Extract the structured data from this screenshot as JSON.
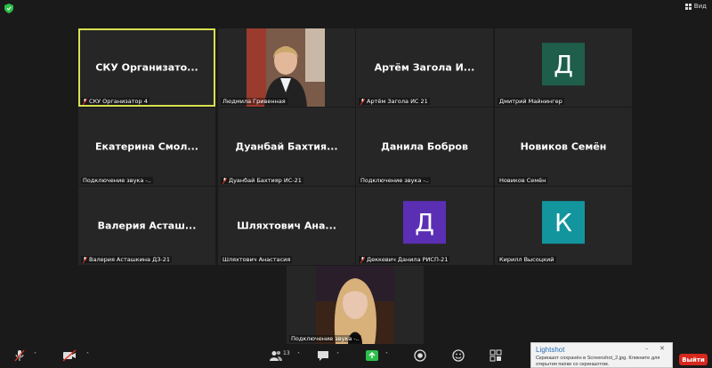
{
  "top_bar": {
    "view_label": "Вид",
    "security_color": "#2dbe4b"
  },
  "participants": [
    {
      "display_name": "СКУ Организато...",
      "label": "СКУ Организатор 4",
      "muted": true,
      "active": true
    },
    {
      "display_name": "",
      "label": "Людмила Гривенная",
      "muted": false,
      "photo": true
    },
    {
      "display_name": "Артём Загола И...",
      "label": "Артём Загола ИС 21",
      "muted": true
    },
    {
      "display_name": "",
      "label": "Дмитрий Майнингер",
      "muted": false,
      "avatar_letter": "Д",
      "avatar_color": "#1e5e4a"
    },
    {
      "display_name": "Екатерина Смол...",
      "label": "Подключение звука -..",
      "muted": false
    },
    {
      "display_name": "Дуанбай Бахтия...",
      "label": "Дуанбай Бахтияр ИС-21",
      "muted": true
    },
    {
      "display_name": "Данила Бобров",
      "label": "Подключение звука -..",
      "muted": false
    },
    {
      "display_name": "Новиков Семён",
      "label": "Новиков Семён",
      "muted": false
    },
    {
      "display_name": "Валерия Асташ...",
      "label": "Валерия Асташкина ДЗ-21",
      "muted": true
    },
    {
      "display_name": "Шляхтович Ана...",
      "label": "Шляхтович Анастасия",
      "muted": false
    },
    {
      "display_name": "",
      "label": "Деккевич Данила РИСП-21",
      "muted": true,
      "avatar_letter": "Д",
      "avatar_color": "#5b2fb3"
    },
    {
      "display_name": "",
      "label": "Кирилл Высоцкий",
      "muted": false,
      "avatar_letter": "К",
      "avatar_color": "#13959e"
    },
    {
      "display_name": "",
      "label": "Подключение звука -..",
      "muted": false,
      "photo": true
    }
  ],
  "toolbar": {
    "participants_count": "13",
    "leave_label": "Выйти"
  },
  "lightshot": {
    "title": "Lightshot",
    "message": "Скриншот сохранён в Screenshot_2.jpg. Кликните для открытия папки со скриншотом."
  }
}
